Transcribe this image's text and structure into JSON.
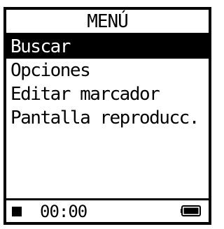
{
  "title": "MENÚ",
  "menu": {
    "items": [
      {
        "label": "Buscar",
        "selected": true
      },
      {
        "label": "Opciones",
        "selected": false
      },
      {
        "label": "Editar marcador",
        "selected": false
      },
      {
        "label": "Pantalla reproducc.",
        "selected": false
      }
    ]
  },
  "status": {
    "playback_icon": "stop-icon",
    "time": "00:00",
    "battery_icon": "battery-icon",
    "battery_level": 1.0
  },
  "colors": {
    "foreground": "#000000",
    "background": "#ffffff"
  }
}
